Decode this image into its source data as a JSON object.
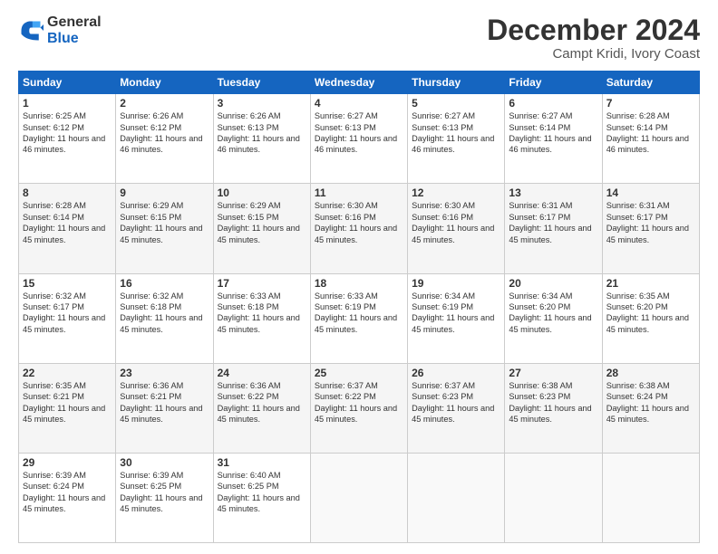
{
  "logo": {
    "general": "General",
    "blue": "Blue"
  },
  "header": {
    "title": "December 2024",
    "subtitle": "Campt Kridi, Ivory Coast"
  },
  "weekdays": [
    "Sunday",
    "Monday",
    "Tuesday",
    "Wednesday",
    "Thursday",
    "Friday",
    "Saturday"
  ],
  "weeks": [
    [
      {
        "day": "1",
        "sunrise": "6:25 AM",
        "sunset": "6:12 PM",
        "daylight": "11 hours and 46 minutes."
      },
      {
        "day": "2",
        "sunrise": "6:26 AM",
        "sunset": "6:12 PM",
        "daylight": "11 hours and 46 minutes."
      },
      {
        "day": "3",
        "sunrise": "6:26 AM",
        "sunset": "6:13 PM",
        "daylight": "11 hours and 46 minutes."
      },
      {
        "day": "4",
        "sunrise": "6:27 AM",
        "sunset": "6:13 PM",
        "daylight": "11 hours and 46 minutes."
      },
      {
        "day": "5",
        "sunrise": "6:27 AM",
        "sunset": "6:13 PM",
        "daylight": "11 hours and 46 minutes."
      },
      {
        "day": "6",
        "sunrise": "6:27 AM",
        "sunset": "6:14 PM",
        "daylight": "11 hours and 46 minutes."
      },
      {
        "day": "7",
        "sunrise": "6:28 AM",
        "sunset": "6:14 PM",
        "daylight": "11 hours and 46 minutes."
      }
    ],
    [
      {
        "day": "8",
        "sunrise": "6:28 AM",
        "sunset": "6:14 PM",
        "daylight": "11 hours and 45 minutes."
      },
      {
        "day": "9",
        "sunrise": "6:29 AM",
        "sunset": "6:15 PM",
        "daylight": "11 hours and 45 minutes."
      },
      {
        "day": "10",
        "sunrise": "6:29 AM",
        "sunset": "6:15 PM",
        "daylight": "11 hours and 45 minutes."
      },
      {
        "day": "11",
        "sunrise": "6:30 AM",
        "sunset": "6:16 PM",
        "daylight": "11 hours and 45 minutes."
      },
      {
        "day": "12",
        "sunrise": "6:30 AM",
        "sunset": "6:16 PM",
        "daylight": "11 hours and 45 minutes."
      },
      {
        "day": "13",
        "sunrise": "6:31 AM",
        "sunset": "6:17 PM",
        "daylight": "11 hours and 45 minutes."
      },
      {
        "day": "14",
        "sunrise": "6:31 AM",
        "sunset": "6:17 PM",
        "daylight": "11 hours and 45 minutes."
      }
    ],
    [
      {
        "day": "15",
        "sunrise": "6:32 AM",
        "sunset": "6:17 PM",
        "daylight": "11 hours and 45 minutes."
      },
      {
        "day": "16",
        "sunrise": "6:32 AM",
        "sunset": "6:18 PM",
        "daylight": "11 hours and 45 minutes."
      },
      {
        "day": "17",
        "sunrise": "6:33 AM",
        "sunset": "6:18 PM",
        "daylight": "11 hours and 45 minutes."
      },
      {
        "day": "18",
        "sunrise": "6:33 AM",
        "sunset": "6:19 PM",
        "daylight": "11 hours and 45 minutes."
      },
      {
        "day": "19",
        "sunrise": "6:34 AM",
        "sunset": "6:19 PM",
        "daylight": "11 hours and 45 minutes."
      },
      {
        "day": "20",
        "sunrise": "6:34 AM",
        "sunset": "6:20 PM",
        "daylight": "11 hours and 45 minutes."
      },
      {
        "day": "21",
        "sunrise": "6:35 AM",
        "sunset": "6:20 PM",
        "daylight": "11 hours and 45 minutes."
      }
    ],
    [
      {
        "day": "22",
        "sunrise": "6:35 AM",
        "sunset": "6:21 PM",
        "daylight": "11 hours and 45 minutes."
      },
      {
        "day": "23",
        "sunrise": "6:36 AM",
        "sunset": "6:21 PM",
        "daylight": "11 hours and 45 minutes."
      },
      {
        "day": "24",
        "sunrise": "6:36 AM",
        "sunset": "6:22 PM",
        "daylight": "11 hours and 45 minutes."
      },
      {
        "day": "25",
        "sunrise": "6:37 AM",
        "sunset": "6:22 PM",
        "daylight": "11 hours and 45 minutes."
      },
      {
        "day": "26",
        "sunrise": "6:37 AM",
        "sunset": "6:23 PM",
        "daylight": "11 hours and 45 minutes."
      },
      {
        "day": "27",
        "sunrise": "6:38 AM",
        "sunset": "6:23 PM",
        "daylight": "11 hours and 45 minutes."
      },
      {
        "day": "28",
        "sunrise": "6:38 AM",
        "sunset": "6:24 PM",
        "daylight": "11 hours and 45 minutes."
      }
    ],
    [
      {
        "day": "29",
        "sunrise": "6:39 AM",
        "sunset": "6:24 PM",
        "daylight": "11 hours and 45 minutes."
      },
      {
        "day": "30",
        "sunrise": "6:39 AM",
        "sunset": "6:25 PM",
        "daylight": "11 hours and 45 minutes."
      },
      {
        "day": "31",
        "sunrise": "6:40 AM",
        "sunset": "6:25 PM",
        "daylight": "11 hours and 45 minutes."
      },
      null,
      null,
      null,
      null
    ]
  ]
}
